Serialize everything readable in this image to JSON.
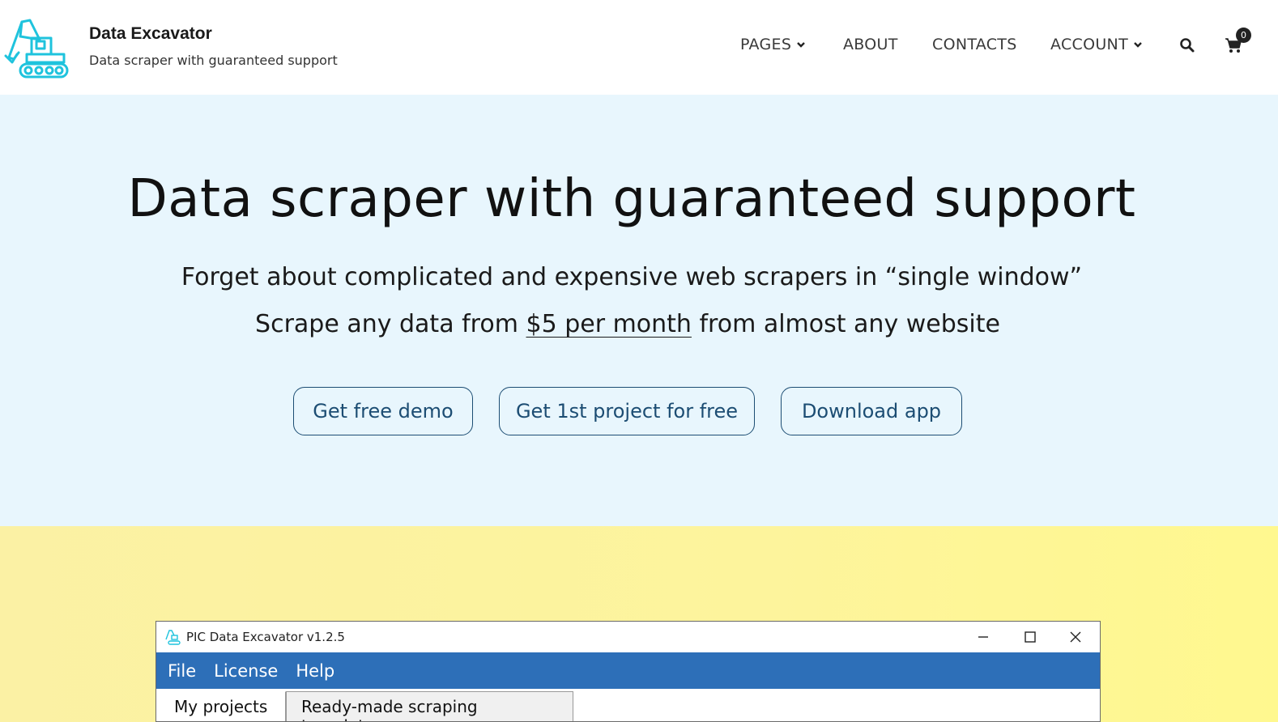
{
  "header": {
    "brand_title": "Data Excavator",
    "brand_subtitle": "Data scraper with guaranteed support",
    "nav": {
      "pages": "PAGES",
      "about": "ABOUT",
      "contacts": "CONTACTS",
      "account": "ACCOUNT"
    },
    "cart_count": "0",
    "logo_color": "#1fc3dd"
  },
  "hero": {
    "title": "Data scraper with guaranteed support",
    "line1": "Forget about complicated and expensive web scrapers in “single window”",
    "line2_prefix": "Scrape any data from ",
    "line2_link": "$5 per month",
    "line2_suffix": " from almost any website",
    "buttons": {
      "demo": "Get free demo",
      "project": "Get 1st project for free",
      "download": "Download app"
    },
    "background": "#e8f6fd",
    "button_color": "#1c4d73"
  },
  "app_window": {
    "title": "PIC Data Excavator v1.2.5",
    "menu": [
      "File",
      "License",
      "Help"
    ],
    "tabs": [
      "My projects",
      "Ready-made scraping templates"
    ],
    "menubar_color": "#2d6fb8"
  }
}
